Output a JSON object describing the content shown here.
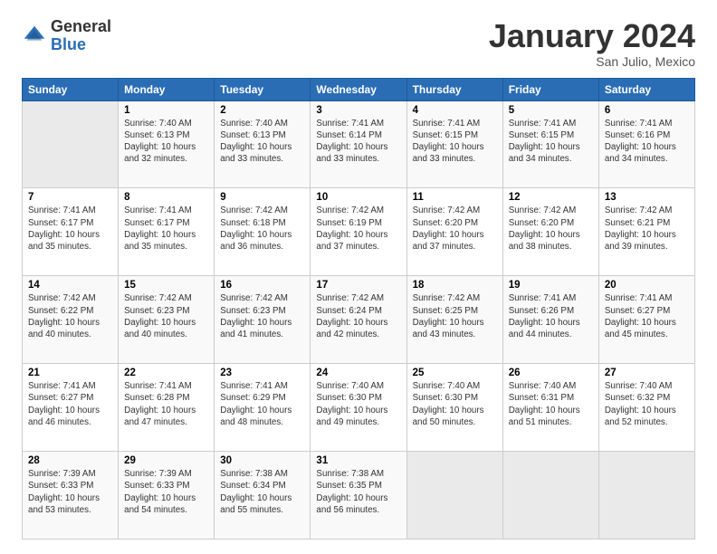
{
  "header": {
    "logo_general": "General",
    "logo_blue": "Blue",
    "month_title": "January 2024",
    "location": "San Julio, Mexico"
  },
  "days_of_week": [
    "Sunday",
    "Monday",
    "Tuesday",
    "Wednesday",
    "Thursday",
    "Friday",
    "Saturday"
  ],
  "weeks": [
    {
      "days": [
        {
          "num": "",
          "sunrise": "",
          "sunset": "",
          "daylight": ""
        },
        {
          "num": "1",
          "sunrise": "Sunrise: 7:40 AM",
          "sunset": "Sunset: 6:13 PM",
          "daylight": "Daylight: 10 hours and 32 minutes."
        },
        {
          "num": "2",
          "sunrise": "Sunrise: 7:40 AM",
          "sunset": "Sunset: 6:13 PM",
          "daylight": "Daylight: 10 hours and 33 minutes."
        },
        {
          "num": "3",
          "sunrise": "Sunrise: 7:41 AM",
          "sunset": "Sunset: 6:14 PM",
          "daylight": "Daylight: 10 hours and 33 minutes."
        },
        {
          "num": "4",
          "sunrise": "Sunrise: 7:41 AM",
          "sunset": "Sunset: 6:15 PM",
          "daylight": "Daylight: 10 hours and 33 minutes."
        },
        {
          "num": "5",
          "sunrise": "Sunrise: 7:41 AM",
          "sunset": "Sunset: 6:15 PM",
          "daylight": "Daylight: 10 hours and 34 minutes."
        },
        {
          "num": "6",
          "sunrise": "Sunrise: 7:41 AM",
          "sunset": "Sunset: 6:16 PM",
          "daylight": "Daylight: 10 hours and 34 minutes."
        }
      ]
    },
    {
      "days": [
        {
          "num": "7",
          "sunrise": "Sunrise: 7:41 AM",
          "sunset": "Sunset: 6:17 PM",
          "daylight": "Daylight: 10 hours and 35 minutes."
        },
        {
          "num": "8",
          "sunrise": "Sunrise: 7:41 AM",
          "sunset": "Sunset: 6:17 PM",
          "daylight": "Daylight: 10 hours and 35 minutes."
        },
        {
          "num": "9",
          "sunrise": "Sunrise: 7:42 AM",
          "sunset": "Sunset: 6:18 PM",
          "daylight": "Daylight: 10 hours and 36 minutes."
        },
        {
          "num": "10",
          "sunrise": "Sunrise: 7:42 AM",
          "sunset": "Sunset: 6:19 PM",
          "daylight": "Daylight: 10 hours and 37 minutes."
        },
        {
          "num": "11",
          "sunrise": "Sunrise: 7:42 AM",
          "sunset": "Sunset: 6:20 PM",
          "daylight": "Daylight: 10 hours and 37 minutes."
        },
        {
          "num": "12",
          "sunrise": "Sunrise: 7:42 AM",
          "sunset": "Sunset: 6:20 PM",
          "daylight": "Daylight: 10 hours and 38 minutes."
        },
        {
          "num": "13",
          "sunrise": "Sunrise: 7:42 AM",
          "sunset": "Sunset: 6:21 PM",
          "daylight": "Daylight: 10 hours and 39 minutes."
        }
      ]
    },
    {
      "days": [
        {
          "num": "14",
          "sunrise": "Sunrise: 7:42 AM",
          "sunset": "Sunset: 6:22 PM",
          "daylight": "Daylight: 10 hours and 40 minutes."
        },
        {
          "num": "15",
          "sunrise": "Sunrise: 7:42 AM",
          "sunset": "Sunset: 6:23 PM",
          "daylight": "Daylight: 10 hours and 40 minutes."
        },
        {
          "num": "16",
          "sunrise": "Sunrise: 7:42 AM",
          "sunset": "Sunset: 6:23 PM",
          "daylight": "Daylight: 10 hours and 41 minutes."
        },
        {
          "num": "17",
          "sunrise": "Sunrise: 7:42 AM",
          "sunset": "Sunset: 6:24 PM",
          "daylight": "Daylight: 10 hours and 42 minutes."
        },
        {
          "num": "18",
          "sunrise": "Sunrise: 7:42 AM",
          "sunset": "Sunset: 6:25 PM",
          "daylight": "Daylight: 10 hours and 43 minutes."
        },
        {
          "num": "19",
          "sunrise": "Sunrise: 7:41 AM",
          "sunset": "Sunset: 6:26 PM",
          "daylight": "Daylight: 10 hours and 44 minutes."
        },
        {
          "num": "20",
          "sunrise": "Sunrise: 7:41 AM",
          "sunset": "Sunset: 6:27 PM",
          "daylight": "Daylight: 10 hours and 45 minutes."
        }
      ]
    },
    {
      "days": [
        {
          "num": "21",
          "sunrise": "Sunrise: 7:41 AM",
          "sunset": "Sunset: 6:27 PM",
          "daylight": "Daylight: 10 hours and 46 minutes."
        },
        {
          "num": "22",
          "sunrise": "Sunrise: 7:41 AM",
          "sunset": "Sunset: 6:28 PM",
          "daylight": "Daylight: 10 hours and 47 minutes."
        },
        {
          "num": "23",
          "sunrise": "Sunrise: 7:41 AM",
          "sunset": "Sunset: 6:29 PM",
          "daylight": "Daylight: 10 hours and 48 minutes."
        },
        {
          "num": "24",
          "sunrise": "Sunrise: 7:40 AM",
          "sunset": "Sunset: 6:30 PM",
          "daylight": "Daylight: 10 hours and 49 minutes."
        },
        {
          "num": "25",
          "sunrise": "Sunrise: 7:40 AM",
          "sunset": "Sunset: 6:30 PM",
          "daylight": "Daylight: 10 hours and 50 minutes."
        },
        {
          "num": "26",
          "sunrise": "Sunrise: 7:40 AM",
          "sunset": "Sunset: 6:31 PM",
          "daylight": "Daylight: 10 hours and 51 minutes."
        },
        {
          "num": "27",
          "sunrise": "Sunrise: 7:40 AM",
          "sunset": "Sunset: 6:32 PM",
          "daylight": "Daylight: 10 hours and 52 minutes."
        }
      ]
    },
    {
      "days": [
        {
          "num": "28",
          "sunrise": "Sunrise: 7:39 AM",
          "sunset": "Sunset: 6:33 PM",
          "daylight": "Daylight: 10 hours and 53 minutes."
        },
        {
          "num": "29",
          "sunrise": "Sunrise: 7:39 AM",
          "sunset": "Sunset: 6:33 PM",
          "daylight": "Daylight: 10 hours and 54 minutes."
        },
        {
          "num": "30",
          "sunrise": "Sunrise: 7:38 AM",
          "sunset": "Sunset: 6:34 PM",
          "daylight": "Daylight: 10 hours and 55 minutes."
        },
        {
          "num": "31",
          "sunrise": "Sunrise: 7:38 AM",
          "sunset": "Sunset: 6:35 PM",
          "daylight": "Daylight: 10 hours and 56 minutes."
        },
        {
          "num": "",
          "sunrise": "",
          "sunset": "",
          "daylight": ""
        },
        {
          "num": "",
          "sunrise": "",
          "sunset": "",
          "daylight": ""
        },
        {
          "num": "",
          "sunrise": "",
          "sunset": "",
          "daylight": ""
        }
      ]
    }
  ]
}
